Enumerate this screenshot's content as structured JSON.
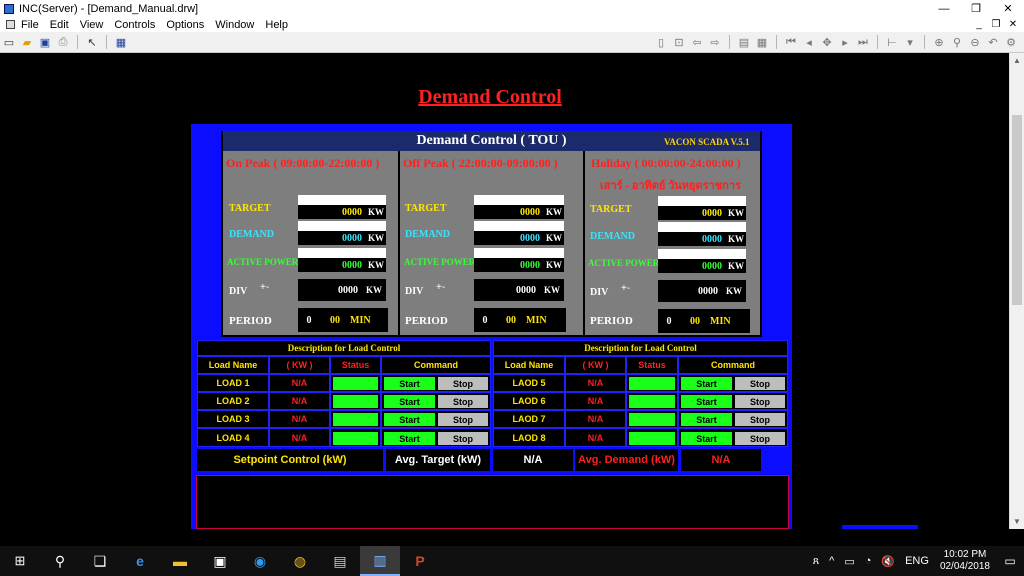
{
  "window": {
    "title": "INC(Server) - [Demand_Manual.drw]",
    "controls": [
      "—",
      "❐",
      "✕"
    ]
  },
  "menu": {
    "items": [
      "File",
      "Edit",
      "View",
      "Controls",
      "Options",
      "Window",
      "Help"
    ],
    "mdi_controls": [
      "_",
      "❐",
      "✕"
    ]
  },
  "toolbar": {
    "left_icons": [
      "new-file-icon",
      "open-folder-icon",
      "save-icon",
      "print-icon",
      "pointer-icon",
      "grid-icon"
    ],
    "right_icons": [
      "document-icon",
      "zoom-icon",
      "back-icon",
      "forward-icon",
      "layout-icon",
      "table-icon",
      "first-icon",
      "prev-icon",
      "play-icon",
      "next-icon",
      "last-icon",
      "align-icon",
      "zoom-in-icon",
      "pin-icon",
      "zoom-out-icon",
      "undo-icon",
      "config-icon"
    ]
  },
  "canvas": {
    "page_title": "Demand Control",
    "tou_title": "Demand Control ( TOU )",
    "version": "VACON SCADA V.5.1",
    "periods": [
      {
        "title": "On Peak ( 09:00:00-22:00:00 )",
        "subtitle": "",
        "target_label": "TARGET",
        "target_value": "0000",
        "target_unit": "KW",
        "demand_label": "DEMAND",
        "demand_value": "0000",
        "demand_unit": "KW",
        "active_label": "ACTIVE POWER",
        "active_value": "0000",
        "active_unit": "KW",
        "div_label": "DIV",
        "div_sign": "+-",
        "div_value": "0000",
        "div_unit": "KW",
        "period_label": "PERIOD",
        "period_hours": "0",
        "period_minutes": "00",
        "period_unit": "MIN"
      },
      {
        "title": "Off Peak  ( 22:00:00-09:00:00 )",
        "subtitle": "",
        "target_label": "TARGET",
        "target_value": "0000",
        "target_unit": "KW",
        "demand_label": "DEMAND",
        "demand_value": "0000",
        "demand_unit": "KW",
        "active_label": "ACTIVE POWER",
        "active_value": "0000",
        "active_unit": "KW",
        "div_label": "DIV",
        "div_sign": "+-",
        "div_value": "0000",
        "div_unit": "KW",
        "period_label": "PERIOD",
        "period_hours": "0",
        "period_minutes": "00",
        "period_unit": "MIN"
      },
      {
        "title": "Holiday  ( 00:00:00-24:00:00 )",
        "subtitle": "เสาร์ - อาทิตย์ วันหยุดราชการ",
        "target_label": "TARGET",
        "target_value": "0000",
        "target_unit": "KW",
        "demand_label": "DEMAND",
        "demand_value": "0000",
        "demand_unit": "KW",
        "active_label": "ACTIVE POWER",
        "active_value": "0000",
        "active_unit": "KW",
        "div_label": "DIV",
        "div_sign": "+-",
        "div_value": "0000",
        "div_unit": "KW",
        "period_label": "PERIOD",
        "period_hours": "0",
        "period_minutes": "00",
        "period_unit": "MIN"
      }
    ],
    "load_tables": [
      {
        "header": "Description for Load Control",
        "columns": [
          "Load Name",
          "( KW )",
          "Status",
          "Command"
        ],
        "rows": [
          {
            "name": "LOAD 1",
            "kw": "N/A",
            "start": "Start",
            "stop": "Stop"
          },
          {
            "name": "LOAD 2",
            "kw": "N/A",
            "start": "Start",
            "stop": "Stop"
          },
          {
            "name": "LOAD 3",
            "kw": "N/A",
            "start": "Start",
            "stop": "Stop"
          },
          {
            "name": "LOAD 4",
            "kw": "N/A",
            "start": "Start",
            "stop": "Stop"
          }
        ]
      },
      {
        "header": "Description for Load Control",
        "columns": [
          "Load Name",
          "( KW )",
          "Status",
          "Command"
        ],
        "rows": [
          {
            "name": "LAOD 5",
            "kw": "N/A",
            "start": "Start",
            "stop": "Stop"
          },
          {
            "name": "LAOD 6",
            "kw": "N/A",
            "start": "Start",
            "stop": "Stop"
          },
          {
            "name": "LAOD 7",
            "kw": "N/A",
            "start": "Start",
            "stop": "Stop"
          },
          {
            "name": "LAOD 8",
            "kw": "N/A",
            "start": "Start",
            "stop": "Stop"
          }
        ]
      }
    ],
    "setpoint": {
      "label": "Setpoint Control (kW)",
      "avg_target_label": "Avg. Target (kW)",
      "avg_target_value": "N/A",
      "avg_demand_label": "Avg. Demand (kW)",
      "avg_demand_value": "N/A"
    }
  },
  "taskbar": {
    "icons": [
      "windows-start-icon",
      "search-icon",
      "task-view-icon",
      "edge-icon",
      "file-explorer-icon",
      "store-icon",
      "browser-icon",
      "chrome-icon",
      "scada-icon",
      "inc-app-icon",
      "powerpoint-icon"
    ],
    "language": "ENG",
    "time": "10:02 PM",
    "date": "02/04/2018"
  },
  "colors": {
    "panel_blue": "#0c0cff",
    "title_red": "#ff2020",
    "target_yellow": "#ffe600",
    "demand_cyan": "#35e5ff",
    "active_green": "#35ff35",
    "status_green": "#1aff1a"
  }
}
